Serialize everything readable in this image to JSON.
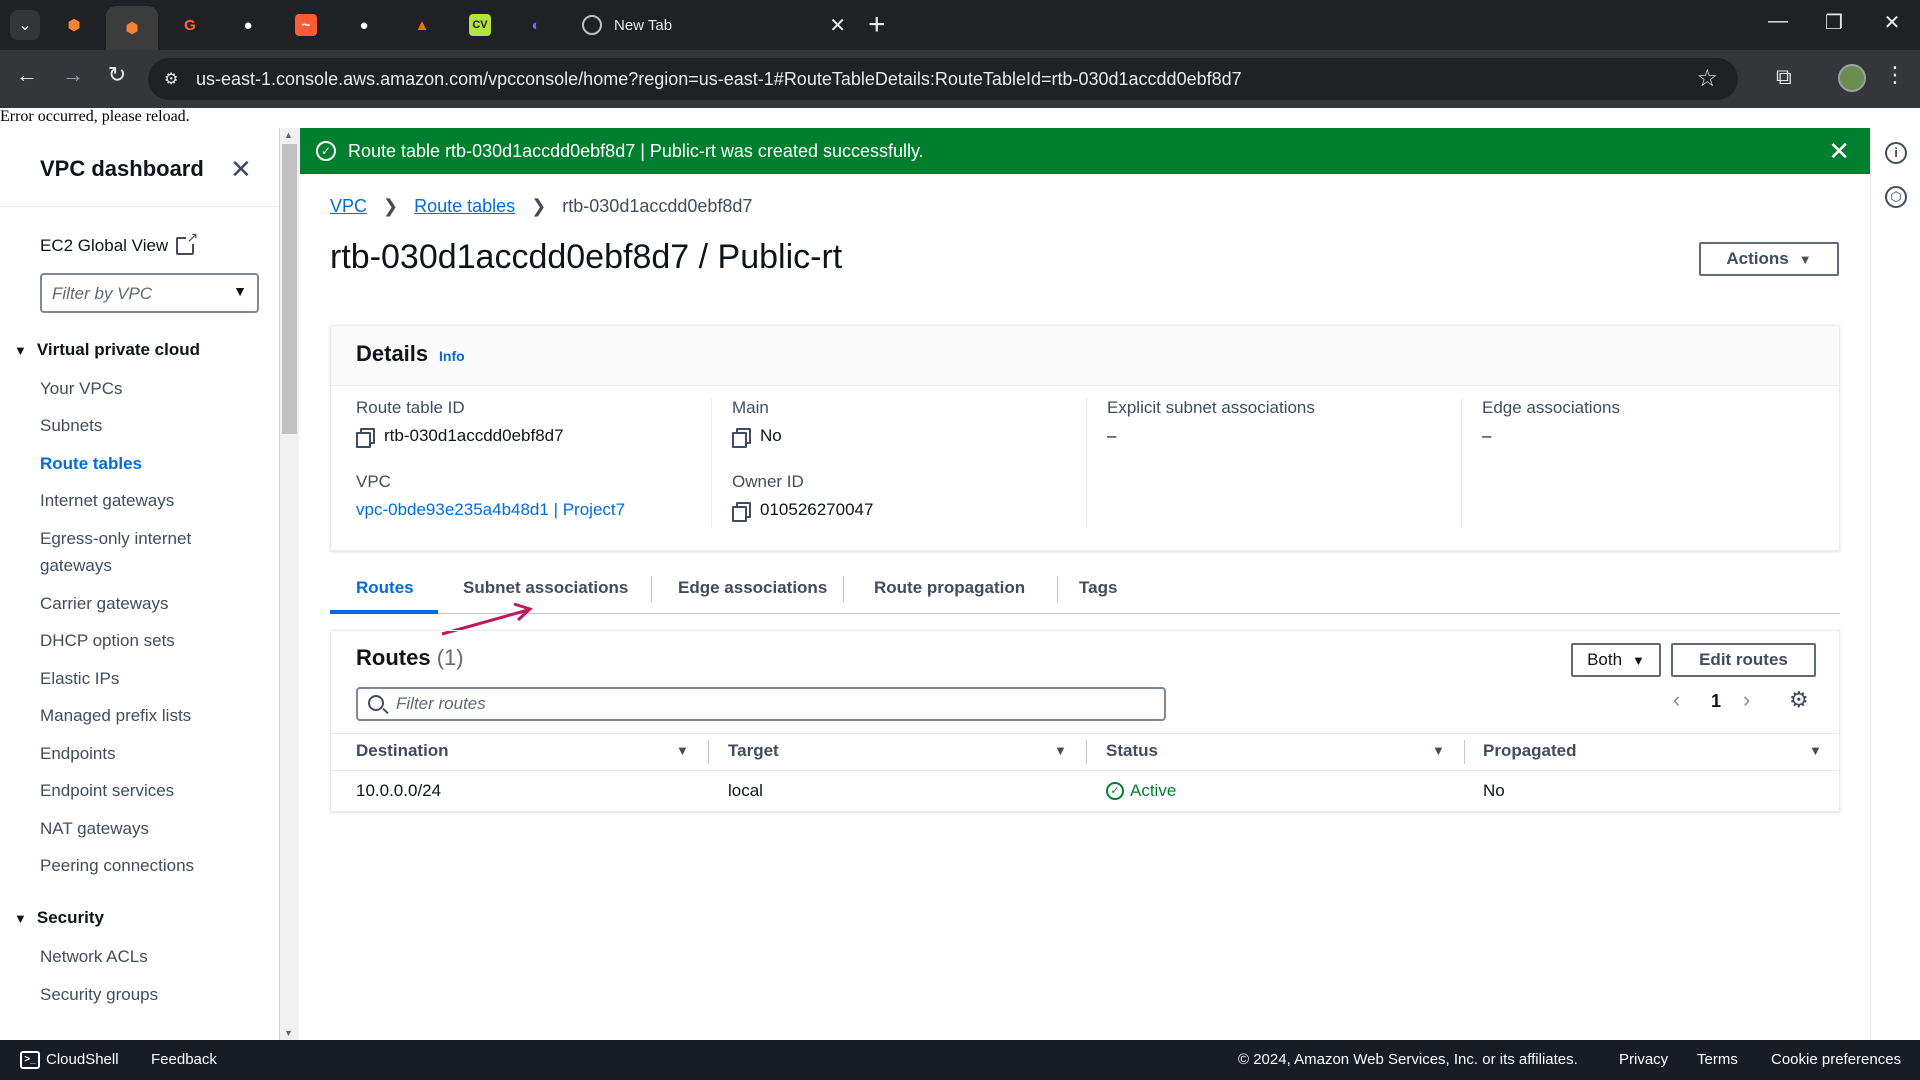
{
  "browser": {
    "tabs": [
      {
        "icon": "aws-icon",
        "color": "#f58536"
      },
      {
        "icon": "aws-icon",
        "color": "#f58536",
        "active": true
      },
      {
        "icon": "g2-icon",
        "color": "#ff6a2b"
      },
      {
        "icon": "github-icon",
        "color": "#ffffff"
      },
      {
        "icon": "bolt-icon",
        "color": "#ff5c35"
      },
      {
        "icon": "github-icon",
        "color": "#ffffff"
      },
      {
        "icon": "fox-icon",
        "color": "#e2761b"
      },
      {
        "icon": "cv-icon",
        "color": "#b4e33d"
      },
      {
        "icon": "swirl-icon",
        "color": "#7b68ee"
      }
    ],
    "new_tab_label": "New Tab",
    "url": "us-east-1.console.aws.amazon.com/vpcconsole/home?region=us-east-1#RouteTableDetails:RouteTableId=rtb-030d1accdd0ebf8d7"
  },
  "page_error": "Error occurred, please reload.",
  "sidebar": {
    "title": "VPC dashboard",
    "global_view": "EC2 Global View",
    "filter_placeholder": "Filter by VPC",
    "section_vpc": "Virtual private cloud",
    "items": [
      {
        "label": "Your VPCs"
      },
      {
        "label": "Subnets"
      },
      {
        "label": "Route tables",
        "active": true
      },
      {
        "label": "Internet gateways"
      },
      {
        "label": "Egress-only internet gateways"
      },
      {
        "label": "Carrier gateways"
      },
      {
        "label": "DHCP option sets"
      },
      {
        "label": "Elastic IPs"
      },
      {
        "label": "Managed prefix lists"
      },
      {
        "label": "Endpoints"
      },
      {
        "label": "Endpoint services"
      },
      {
        "label": "NAT gateways"
      },
      {
        "label": "Peering connections"
      }
    ],
    "section_security": "Security",
    "security_items": [
      {
        "label": "Network ACLs"
      },
      {
        "label": "Security groups"
      }
    ]
  },
  "flash": {
    "message": "Route table rtb-030d1accdd0ebf8d7 | Public-rt was created successfully.",
    "color": "#00802f"
  },
  "breadcrumb": {
    "vpc": "VPC",
    "route_tables": "Route tables",
    "current": "rtb-030d1accdd0ebf8d7"
  },
  "page_title": "rtb-030d1accdd0ebf8d7 / Public-rt",
  "actions_label": "Actions",
  "details": {
    "title": "Details",
    "info": "Info",
    "route_table_id_label": "Route table ID",
    "route_table_id": "rtb-030d1accdd0ebf8d7",
    "vpc_label": "VPC",
    "vpc_value": "vpc-0bde93e235a4b48d1 | Project7",
    "main_label": "Main",
    "main_value": "No",
    "owner_label": "Owner ID",
    "owner_value": "010526270047",
    "explicit_label": "Explicit subnet associations",
    "explicit_value": "–",
    "edge_label": "Edge associations",
    "edge_value": "–"
  },
  "tabs": [
    "Routes",
    "Subnet associations",
    "Edge associations",
    "Route propagation",
    "Tags"
  ],
  "routes": {
    "title": "Routes",
    "count": "(1)",
    "filter_label": "Both",
    "edit_label": "Edit routes",
    "search_placeholder": "Filter routes",
    "page": "1",
    "columns": [
      "Destination",
      "Target",
      "Status",
      "Propagated"
    ],
    "rows": [
      {
        "destination": "10.0.0.0/24",
        "target": "local",
        "status": "Active",
        "propagated": "No"
      }
    ]
  },
  "footer": {
    "cloudshell": "CloudShell",
    "feedback": "Feedback",
    "copyright": "© 2024, Amazon Web Services, Inc. or its affiliates.",
    "privacy": "Privacy",
    "terms": "Terms",
    "cookies": "Cookie preferences"
  }
}
